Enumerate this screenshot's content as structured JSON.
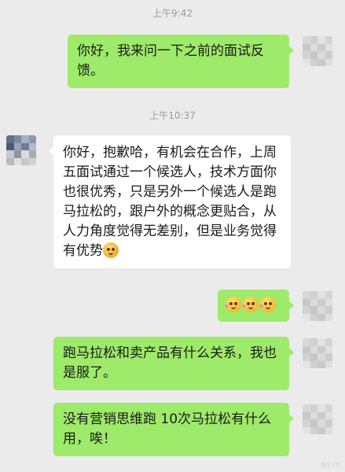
{
  "timestamps": [
    "上午9:42",
    "上午10:37"
  ],
  "messages": [
    {
      "side": "right",
      "text": "你好，我来问一下之前的面试反馈。"
    },
    {
      "side": "left",
      "text": "你好，抱歉哈，有机会在合作，上周五面试通过一个候选人，技术方面你也很优秀，只是另外一个候选人是跑马拉松的，跟户外的概念更贴合，从人力角度觉得无差别，但是业务觉得有优势",
      "trailing_emoji": "sweat-smile-emoji"
    },
    {
      "side": "right",
      "emoji": [
        "pleading-emoji",
        "pleading-emoji",
        "pleading-emoji"
      ]
    },
    {
      "side": "right",
      "text": "跑马拉松和卖产品有什么关系，我也是服了。"
    },
    {
      "side": "right",
      "text": "没有营销思维跑 10次马拉松有什么用，唉！"
    }
  ],
  "watermark": "qq.cn",
  "colors": {
    "background": "#ebebeb",
    "sent_bubble": "#9eea6a",
    "received_bubble": "#ffffff"
  }
}
